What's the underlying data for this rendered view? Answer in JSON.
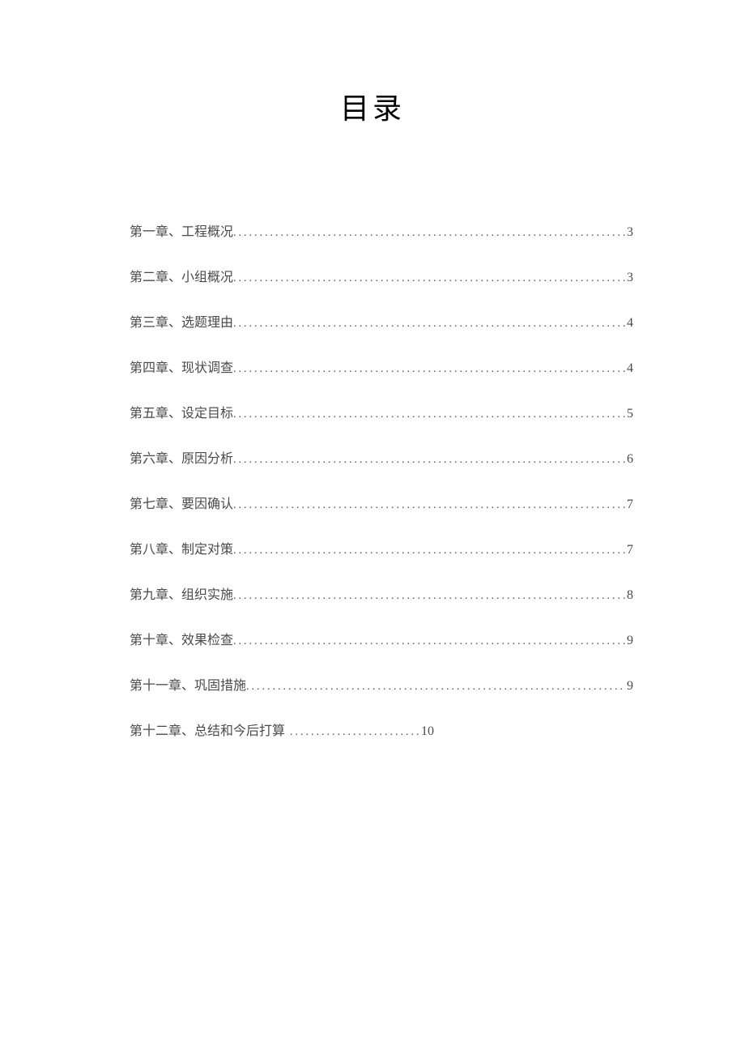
{
  "title": "目录",
  "toc": {
    "entries": [
      {
        "label": "第一章、工程概况",
        "page": "3"
      },
      {
        "label": "第二章、小组概况",
        "page": "3"
      },
      {
        "label": "第三章、选题理由",
        "page": "4"
      },
      {
        "label": "第四章、现状调查",
        "page": "4"
      },
      {
        "label": "第五章、设定目标",
        "page": "5"
      },
      {
        "label": "第六章、原因分析",
        "page": "6"
      },
      {
        "label": "第七章、要因确认",
        "page": "7"
      },
      {
        "label": "第八章、制定对策",
        "page": "7"
      },
      {
        "label": "第九章、组织实施",
        "page": "8"
      },
      {
        "label": "第十章、效果检查",
        "page": "9"
      },
      {
        "label": "第十一章、巩固措施",
        "page": "9"
      }
    ],
    "last": {
      "label": "第十二章、总结和今后打算",
      "page": "10"
    }
  }
}
